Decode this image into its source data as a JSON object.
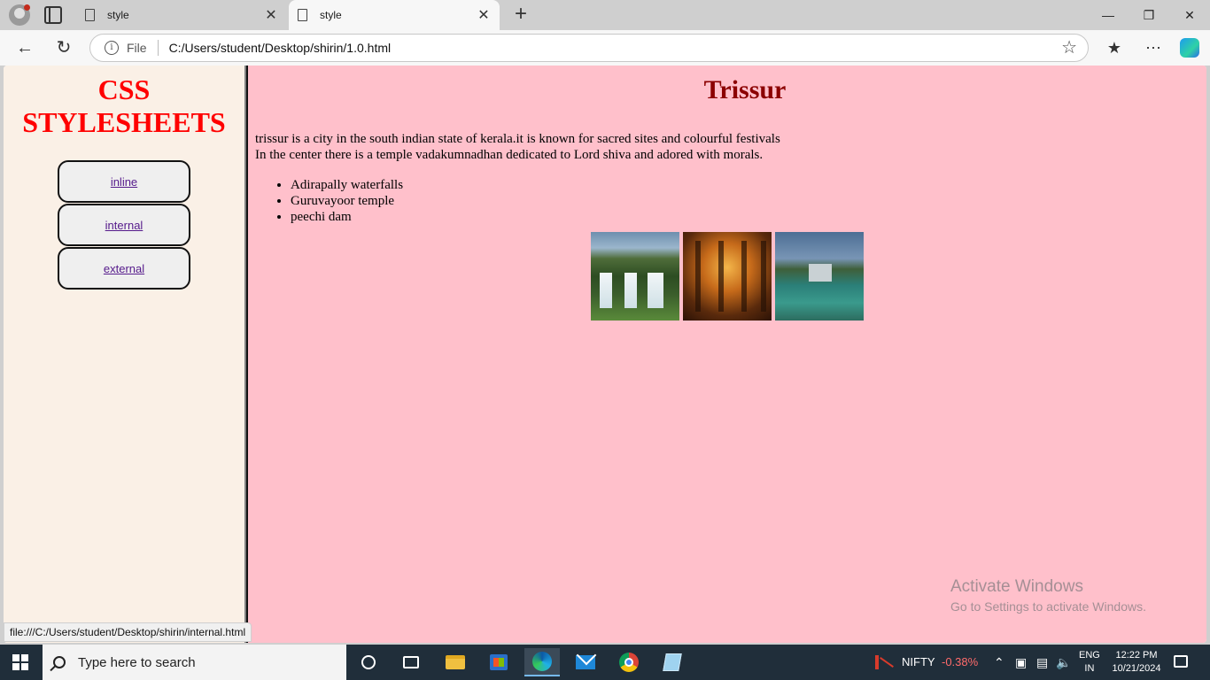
{
  "browser": {
    "tabs": [
      {
        "title": "style",
        "active": false
      },
      {
        "title": "style",
        "active": true
      }
    ],
    "address": {
      "scheme_label": "File",
      "url": "C:/Users/student/Desktop/shirin/1.0.html"
    },
    "status_url": "file:///C:/Users/student/Desktop/shirin/internal.html"
  },
  "left_frame": {
    "title": "CSS STYLESHEETS",
    "menu": [
      {
        "label": "inline"
      },
      {
        "label": "internal"
      },
      {
        "label": "external"
      }
    ]
  },
  "right_frame": {
    "title": "Trissur",
    "paragraph_line1": "trissur is a city in the south indian state of kerala.it is known for sacred sites and colourful festivals",
    "paragraph_line2": "In the center there is a temple vadakumnadhan dedicated to Lord shiva and adored with morals.",
    "places": [
      "Adirapally waterfalls",
      "Guruvayoor temple",
      "peechi dam"
    ]
  },
  "watermark": {
    "title": "Activate Windows",
    "subtitle": "Go to Settings to activate Windows."
  },
  "taskbar": {
    "search_placeholder": "Type here to search",
    "ticker_name": "NIFTY",
    "ticker_value": "-0.38%",
    "lang_line1": "ENG",
    "lang_line2": "IN",
    "time": "12:22 PM",
    "date": "10/21/2024"
  },
  "colors": {
    "left_bg": "#faf0e6",
    "right_bg": "#ffc0cb",
    "brand_title": "#ff0000",
    "city_title": "#8b0000",
    "taskbar": "#202e3a"
  }
}
